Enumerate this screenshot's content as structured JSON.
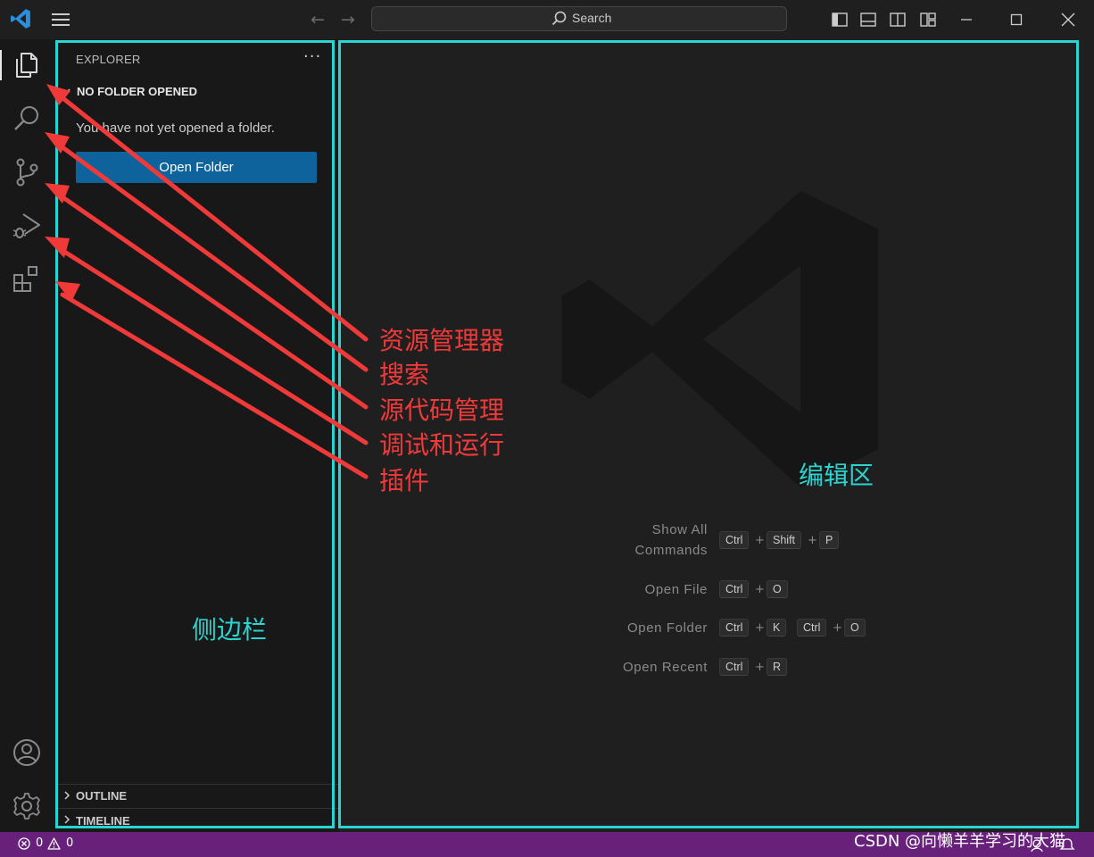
{
  "titlebar": {
    "search_placeholder": "Search"
  },
  "activitybar": {
    "items": [
      {
        "icon": "files-icon"
      },
      {
        "icon": "search-icon"
      },
      {
        "icon": "source-control-icon"
      },
      {
        "icon": "run-debug-icon"
      },
      {
        "icon": "extensions-icon"
      }
    ],
    "bottom": [
      {
        "icon": "account-icon"
      },
      {
        "icon": "gear-icon"
      }
    ]
  },
  "sidebar": {
    "title": "EXPLORER",
    "more": "···",
    "section_title": "NO FOLDER OPENED",
    "message": "You have not yet opened a folder.",
    "open_folder_label": "Open Folder",
    "outline_label": "OUTLINE",
    "timeline_label": "TIMELINE"
  },
  "editor": {
    "shortcuts": [
      {
        "label_line1": "Show All",
        "label_line2": "Commands",
        "keys": [
          "Ctrl",
          "+",
          "Shift",
          "+",
          "P"
        ]
      },
      {
        "label": "Open File",
        "keys": [
          "Ctrl",
          "+",
          "O"
        ]
      },
      {
        "label": "Open Folder",
        "keys": [
          "Ctrl",
          "+",
          "K",
          "Ctrl",
          "+",
          "O"
        ]
      },
      {
        "label": "Open Recent",
        "keys": [
          "Ctrl",
          "+",
          "R"
        ]
      }
    ]
  },
  "statusbar": {
    "errors": "0",
    "warnings": "0",
    "color": "#68217a"
  },
  "watermark_text": "CSDN @向懒羊羊学习的大猫",
  "annotations": {
    "red_color": "#f03a3a",
    "cyan_color": "#2ad4d0",
    "explorer": "资源管理器",
    "search": "搜索",
    "source_control": "源代码管理",
    "run_debug": "调试和运行",
    "extensions": "插件",
    "sidebar": "侧边栏",
    "editor": "编辑区"
  }
}
